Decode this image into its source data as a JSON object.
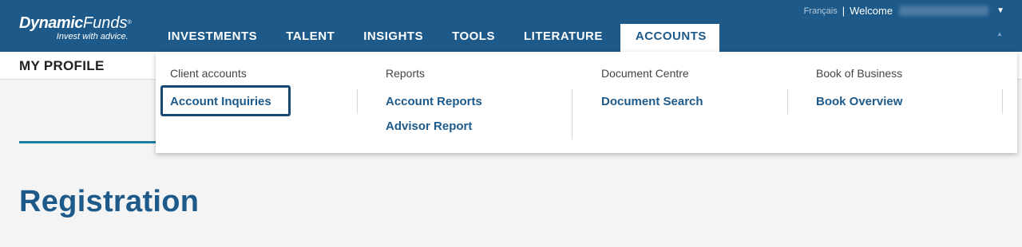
{
  "brand": {
    "name_bold": "Dynamic",
    "name_light": "Funds",
    "reg": "®",
    "tagline": "Invest with advice."
  },
  "topbar": {
    "language": "Français",
    "separator": "|",
    "welcome": "Welcome",
    "caret": "▼"
  },
  "nav": {
    "items": [
      {
        "label": "INVESTMENTS"
      },
      {
        "label": "TALENT"
      },
      {
        "label": "INSIGHTS"
      },
      {
        "label": "TOOLS"
      },
      {
        "label": "LITERATURE"
      },
      {
        "label": "ACCOUNTS"
      }
    ],
    "active": "ACCOUNTS"
  },
  "page": {
    "section_title": "MY PROFILE",
    "heading": "Registration"
  },
  "dropdown": {
    "columns": [
      {
        "heading": "Client accounts",
        "links": [
          "Account Inquiries"
        ]
      },
      {
        "heading": "Reports",
        "links": [
          "Account Reports",
          "Advisor Report"
        ]
      },
      {
        "heading": "Document Centre",
        "links": [
          "Document Search"
        ]
      },
      {
        "heading": "Book of Business",
        "links": [
          "Book Overview"
        ]
      }
    ]
  },
  "colors": {
    "header_bg": "#1d5a8a",
    "accent_teal": "#1b7f9e",
    "link": "#1d5a8a",
    "highlight_border": "#164a75"
  }
}
